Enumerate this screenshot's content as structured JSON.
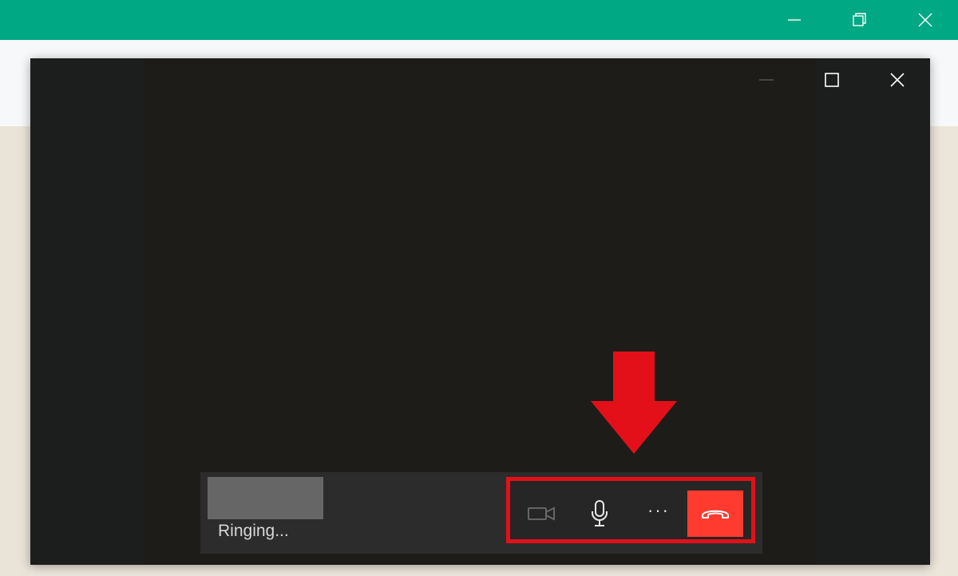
{
  "outer_window": {
    "accent_color": "#00a884",
    "controls": {
      "minimize_icon": "minimize-icon",
      "restore_icon": "restore-icon",
      "close_icon": "close-icon"
    }
  },
  "call_window": {
    "controls": {
      "minimize_icon": "minimize-icon",
      "maximize_icon": "maximize-icon",
      "close_icon": "close-icon"
    },
    "status_text": "Ringing...",
    "actions": {
      "video_icon": "video-camera-icon",
      "mic_icon": "microphone-icon",
      "more_icon": "more-options-icon",
      "more_glyph": "···",
      "end_call_icon": "end-call-icon",
      "end_call_color": "#ff3b30"
    },
    "highlight_color": "#e3101a"
  },
  "annotation": {
    "arrow_color": "#e3101a",
    "arrow_icon": "down-arrow-icon"
  }
}
